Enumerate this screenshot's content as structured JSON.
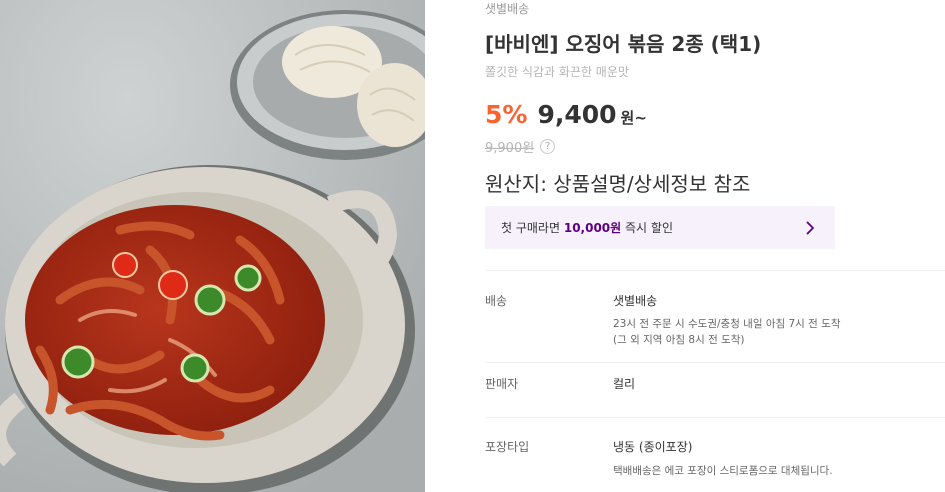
{
  "product": {
    "delivery_tag": "샛별배송",
    "title": "[바비엔] 오징어 볶음 2종 (택1)",
    "subtitle": "쫄깃한 식감과 화끈한 매운맛",
    "discount": "5%",
    "price": "9,400",
    "price_unit": "원~",
    "original_price": "9,900원",
    "origin": "원산지: 상품설명/상세정보 참조",
    "image_icon": "stir-fried-squid-photo"
  },
  "coupon": {
    "prefix": "첫 구매라면 ",
    "highlight": "10,000원",
    "suffix": " 즉시 할인",
    "accent_color": "#5f0080",
    "background_color": "#f6f1fb"
  },
  "info_rows": [
    {
      "label": "배송",
      "value": "샛별배송",
      "details": [
        "23시 전 주문 시 수도권/충청 내일 아침 7시 전 도착",
        "(그 외 지역 아침 8시 전 도착)"
      ]
    },
    {
      "label": "판매자",
      "value": "컬리",
      "details": []
    },
    {
      "label": "포장타입",
      "value": "냉동 (종이포장)",
      "details": [
        "택배배송은 에코 포장이 스티로폼으로 대체됩니다."
      ]
    }
  ],
  "colors": {
    "discount": "#fa622f",
    "text": "#333333",
    "muted": "#999999"
  }
}
